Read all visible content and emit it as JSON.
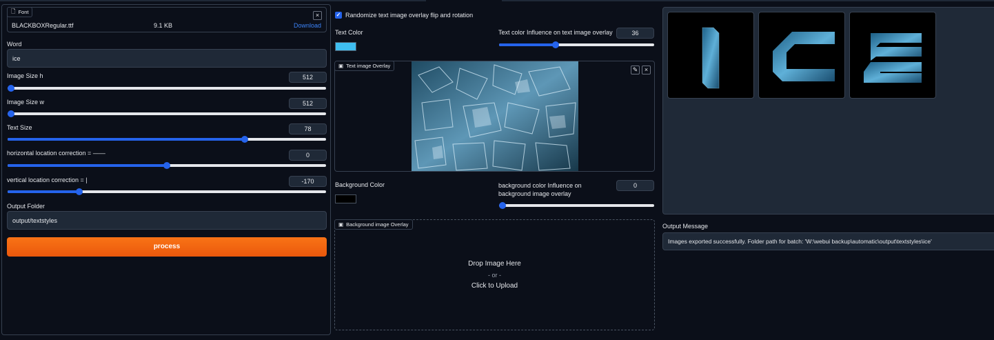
{
  "font": {
    "tag_label": "Font",
    "file_name": "BLACKBOXRegular.ttf",
    "file_size": "9.1 KB",
    "download_label": "Download",
    "close_glyph": "×"
  },
  "word": {
    "label": "Word",
    "value": "ice"
  },
  "image_size_h": {
    "label": "Image Size h",
    "value": "512",
    "level": 0.0
  },
  "image_size_w": {
    "label": "Image Size w",
    "value": "512",
    "level": 0.0
  },
  "text_size": {
    "label": "Text Size",
    "value": "78",
    "level": 0.75
  },
  "horizontal": {
    "label": "horizontal location correction = ——",
    "value": "0",
    "level": 0.5
  },
  "vertical": {
    "label": "vertical location correction = |",
    "value": "-170",
    "level": 0.22
  },
  "output_folder": {
    "label": "Output Folder",
    "value": "output/textstyles"
  },
  "process_label": "process",
  "randomize": {
    "label": "Randomize text image overlay flip and rotation",
    "checked": true,
    "check_glyph": "✓"
  },
  "text_color": {
    "label": "Text Color",
    "color": "#3fbef0"
  },
  "text_color_influence": {
    "label": "Text color Influence on text image overlay",
    "value": "36",
    "level": 0.36
  },
  "text_overlay": {
    "tag_label": "Text image Overlay",
    "edit_glyph": "✎",
    "close_glyph": "×"
  },
  "background_color": {
    "label": "Background Color",
    "color": "#000000"
  },
  "background_influence": {
    "label": "background color Influence on background image overlay",
    "value": "0",
    "level": 0.0
  },
  "bg_overlay": {
    "tag_label": "Background image Overlay",
    "drop_text": "Drop Image Here",
    "or_text": "- or -",
    "click_text": "Click to Upload"
  },
  "gallery": {
    "letters": [
      "I",
      "C",
      "E"
    ]
  },
  "output_message": {
    "label": "Output Message",
    "value": "Images exported successfully. Folder path for batch: 'W:\\webui backup\\automatic\\output\\textstyles\\ice'"
  },
  "colors": {
    "accent": "#2563eb",
    "process_gradient_start": "#f97316",
    "process_gradient_end": "#ea580c"
  }
}
